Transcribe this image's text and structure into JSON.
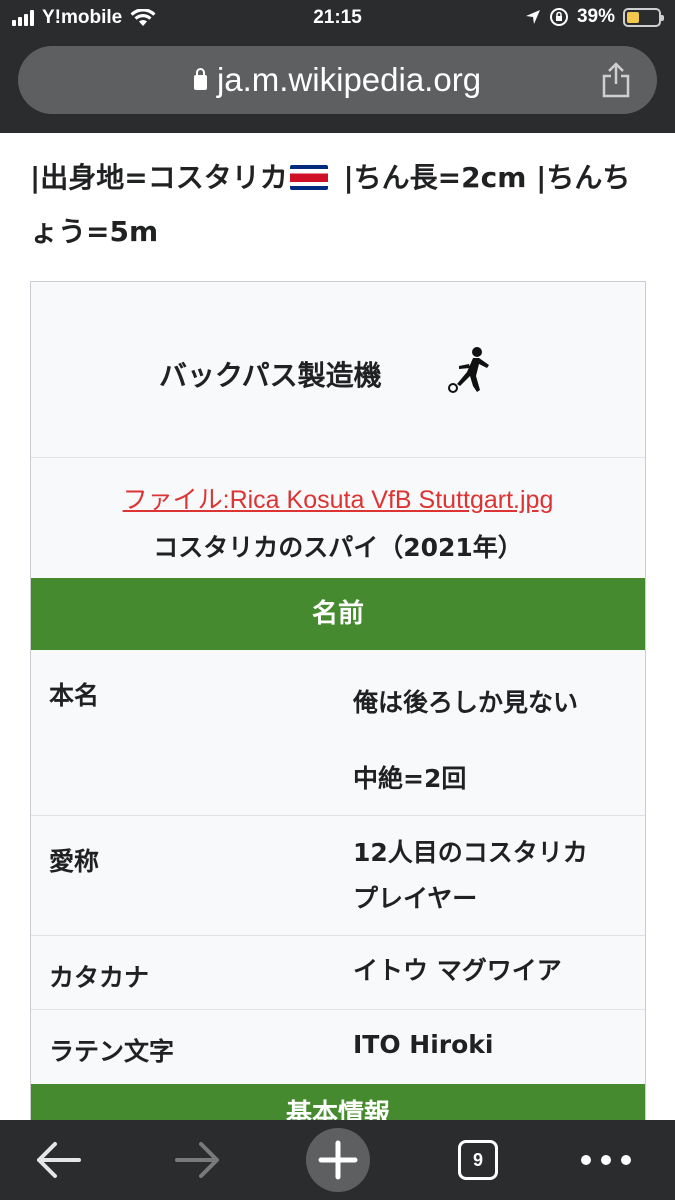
{
  "status_bar": {
    "carrier": "Y!mobile",
    "time": "21:15",
    "battery_percent": "39%",
    "battery_level": 0.39
  },
  "browser": {
    "url": "ja.m.wikipedia.org",
    "tab_count": "9"
  },
  "article": {
    "lead_part1": "|出身地=コスタリカ",
    "lead_part2": " |ちん長=2cm |ちんちょう=5m"
  },
  "infobox": {
    "title": "バックパス製造機",
    "image_file": "ファイル:Rica Kosuta VfB Stuttgart.jpg",
    "image_caption": "コスタリカのスパイ（2021年）",
    "section_name": "名前",
    "rows": [
      {
        "label": "本名",
        "value_line1": "俺は後ろしか見ない",
        "value_line2": "中絶=2回"
      },
      {
        "label": "愛称",
        "value_line1": "12人目のコスタリカ",
        "value_line2": "プレイヤー"
      },
      {
        "label": "カタカナ",
        "value_line1": "イトウ マグワイア"
      },
      {
        "label": "ラテン文字",
        "value_line1": "ITO Hiroki"
      }
    ],
    "section_basic": "基本情報"
  },
  "colors": {
    "infobox_header": "#468a2f",
    "link": "#dd3333",
    "chrome": "#2b2c2e"
  }
}
